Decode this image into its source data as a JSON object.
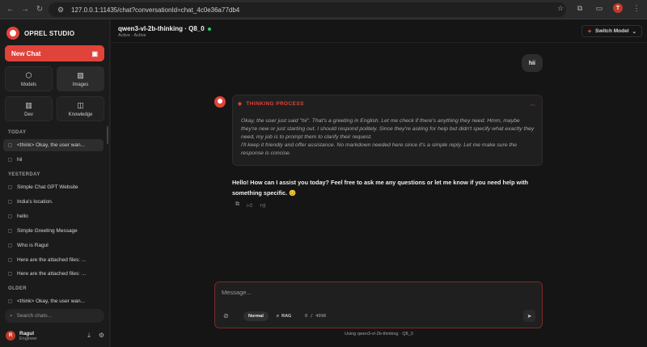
{
  "browser": {
    "url": "127.0.0.1:11435/chat?conversationId=chat_4c0e36a77db4",
    "profile_initial": "T"
  },
  "sidebar": {
    "brand": "OPREL STUDIO",
    "new_chat_label": "New Chat",
    "tiles": [
      {
        "label": "Models",
        "icon": "cube-icon"
      },
      {
        "label": "Images",
        "icon": "image-icon"
      },
      {
        "label": "Dev",
        "icon": "bar-chart-icon"
      },
      {
        "label": "Knowledge",
        "icon": "database-icon"
      }
    ],
    "sections": {
      "today": "TODAY",
      "yesterday": "YESTERDAY",
      "older": "OLDER"
    },
    "today_items": [
      "<think> Okay, the user wan...",
      "hii"
    ],
    "yesterday_items": [
      "Simple Chat GPT Website",
      "India's location.",
      "hello",
      "Simple Greeting Message",
      "Who is Ragul",
      "Here are the attached files: ...",
      "Here are the attached files: ..."
    ],
    "older_items": [
      "<think> Okay, the user wan..."
    ],
    "search_placeholder": "Search chats...",
    "user": {
      "initial": "R",
      "name": "Ragul",
      "role": "Engineer"
    }
  },
  "header": {
    "model_title": "qwen3-vl-2b-thinking · Q8_0",
    "model_status": "Active · Active",
    "switch_model_label": "Switch Model"
  },
  "conversation": {
    "user_message": "hii",
    "thinking_label": "THINKING PROCESS",
    "thinking_text_1": "Okay, the user just said \"hii\". That's a greeting in English. Let me check if there's anything they need. Hmm, maybe they're new or just starting out. I should respond politely. Since they're asking for help but didn't specify what exactly they need, my job is to prompt them to clarify their request.",
    "thinking_text_2": "I'll keep it friendly and offer assistance. No markdown needed here since it's a simple reply. Let me make sure the response is concise.",
    "answer": "Hello! How can I assist you today? Feel free to ask me any questions or let me know if you need help with something specific. 😊"
  },
  "composer": {
    "placeholder": "Message...",
    "mode_normal": "Normal",
    "mode_rag": "RAG",
    "counter": "0 / 4096",
    "footer_note": "Using qwen3-vl-2b-thinking · Q8_0"
  },
  "colors": {
    "accent": "#e0433a",
    "status_active": "#2ecc71"
  }
}
